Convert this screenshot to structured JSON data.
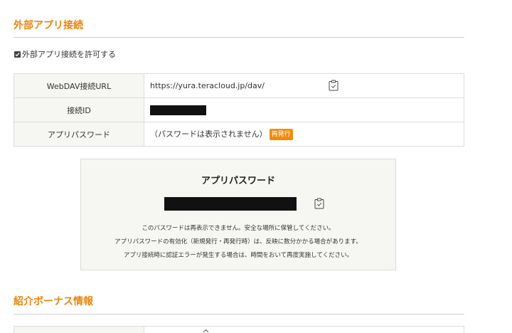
{
  "external_app": {
    "title": "外部アプリ接続",
    "allow_label": "外部アプリ接続を許可する",
    "allow_checked": true,
    "rows": [
      {
        "label": "WebDAV接続URL",
        "value": "https://yura.teracloud.jp/dav/"
      },
      {
        "label": "接続ID",
        "value": ""
      },
      {
        "label": "アプリパスワード",
        "value": "（パスワードは表示されません）",
        "button": "再発行"
      }
    ]
  },
  "password_panel": {
    "title": "アプリパスワード",
    "notes": [
      "このパスワードは再表示できません。安全な場所に保管してください。",
      "アプリパスワードの有効化（新規発行・再発行時）は、反映に数分かかる場合があります。",
      "アプリ接続時に認証エラーが発生する場合は、時間をおいて再度実施してください。"
    ]
  },
  "referral": {
    "title": "紹介ボーナス情報"
  },
  "colors": {
    "accent": "#e8850f",
    "button": "#f08c0a",
    "label_bg": "#f6f6f2"
  },
  "icons": {
    "copy": "clipboard-check-icon"
  }
}
